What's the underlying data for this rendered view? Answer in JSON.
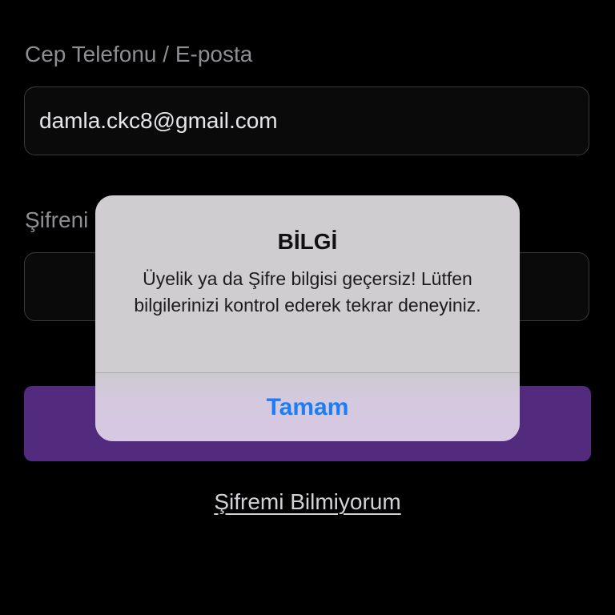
{
  "form": {
    "phone_email_label": "Cep Telefonu / E-posta",
    "email_value": "damla.ckc8@gmail.com",
    "password_label": "Şifreni",
    "password_value": "",
    "forgot_password_link": "Şifremi Bilmiyorum"
  },
  "alert": {
    "title": "BİLGİ",
    "message": "Üyelik ya da Şifre bilgisi geçersiz! Lütfen bilgilerinizi kontrol ederek tekrar deneyiniz.",
    "button_label": "Tamam"
  },
  "colors": {
    "background": "#000000",
    "primary_button": "#522b7e",
    "alert_action": "#1c7ef5"
  }
}
